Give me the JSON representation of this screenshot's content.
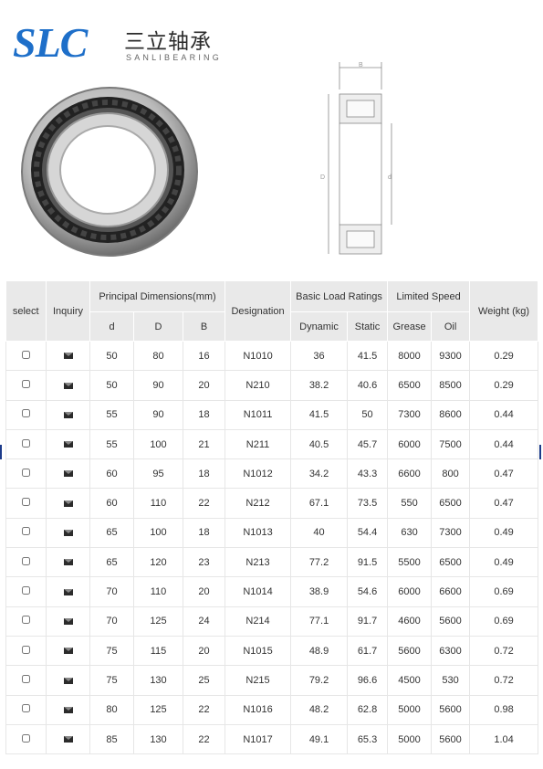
{
  "brand": {
    "mark": "SLC",
    "name_cn": "三立轴承",
    "name_en": "SANLIBEARING"
  },
  "drawing_labels": {
    "B": "B",
    "D": "D",
    "d": "d"
  },
  "table": {
    "headers": {
      "select": "select",
      "inquiry": "Inquiry",
      "principal": "Principal Dimensions(mm)",
      "designation": "Designation",
      "load": "Basic Load Ratings",
      "speed": "Limited Speed",
      "weight": "Weight  (kg)",
      "d": "d",
      "D": "D",
      "B": "B",
      "dynamic": "Dynamic",
      "static": "Static",
      "grease": "Grease",
      "oil": "Oil"
    },
    "rows": [
      [
        "50",
        "80",
        "16",
        "N1010",
        "36",
        "41.5",
        "8000",
        "9300",
        "0.29"
      ],
      [
        "50",
        "90",
        "20",
        "N210",
        "38.2",
        "40.6",
        "6500",
        "8500",
        "0.29"
      ],
      [
        "55",
        "90",
        "18",
        "N1011",
        "41.5",
        "50",
        "7300",
        "8600",
        "0.44"
      ],
      [
        "55",
        "100",
        "21",
        "N211",
        "40.5",
        "45.7",
        "6000",
        "7500",
        "0.44"
      ],
      [
        "60",
        "95",
        "18",
        "N1012",
        "34.2",
        "43.3",
        "6600",
        "800",
        "0.47"
      ],
      [
        "60",
        "110",
        "22",
        "N212",
        "67.1",
        "73.5",
        "550",
        "6500",
        "0.47"
      ],
      [
        "65",
        "100",
        "18",
        "N1013",
        "40",
        "54.4",
        "630",
        "7300",
        "0.49"
      ],
      [
        "65",
        "120",
        "23",
        "N213",
        "77.2",
        "91.5",
        "5500",
        "6500",
        "0.49"
      ],
      [
        "70",
        "110",
        "20",
        "N1014",
        "38.9",
        "54.6",
        "6000",
        "6600",
        "0.69"
      ],
      [
        "70",
        "125",
        "24",
        "N214",
        "77.1",
        "91.7",
        "4600",
        "5600",
        "0.69"
      ],
      [
        "75",
        "115",
        "20",
        "N1015",
        "48.9",
        "61.7",
        "5600",
        "6300",
        "0.72"
      ],
      [
        "75",
        "130",
        "25",
        "N215",
        "79.2",
        "96.6",
        "4500",
        "530",
        "0.72"
      ],
      [
        "80",
        "125",
        "22",
        "N1016",
        "48.2",
        "62.8",
        "5000",
        "5600",
        "0.98"
      ],
      [
        "85",
        "130",
        "22",
        "N1017",
        "49.1",
        "65.3",
        "5000",
        "5600",
        "1.04"
      ]
    ]
  }
}
